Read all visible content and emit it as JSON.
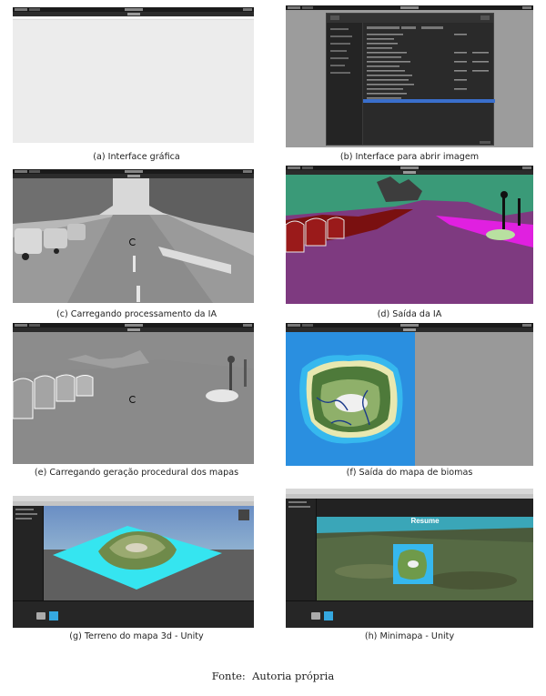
{
  "captions": {
    "a": "(a) Interface gráfica",
    "b": "(b) Interface para abrir imagem",
    "c": "(c) Carregando processamento da IA",
    "d": "(d) Saída da IA",
    "e": "(e) Carregando geração procedural dos mapas",
    "f": "(f) Saída do mapa de biomas",
    "g": "(g) Terreno do mapa 3d - Unity",
    "h": "(h) Minimapa - Unity"
  },
  "minimap": {
    "resume_label": "Resume"
  },
  "source": "Fonte:  Autoria própria",
  "colors": {
    "seg_sky": "#3a9a78",
    "seg_road": "#7e3a80",
    "seg_car": "#8b1010",
    "seg_sidewalk": "#e020e0",
    "biome_ocean": "#2a8fe0",
    "biome_shallow": "#36b8ee",
    "unity_plane": "#35e5f0"
  },
  "icons": [
    "spinner-icon",
    "folder-icon"
  ]
}
